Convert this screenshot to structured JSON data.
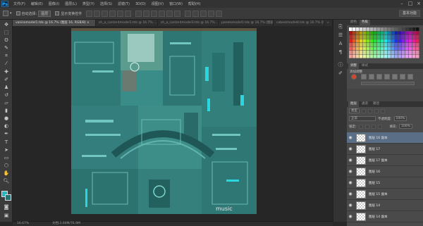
{
  "app": {
    "logo": "Ps"
  },
  "menubar": {
    "items": [
      "文件(F)",
      "编辑(E)",
      "图像(I)",
      "图层(L)",
      "类型(Y)",
      "选择(S)",
      "滤镜(T)",
      "3D(D)",
      "视图(V)",
      "窗口(W)",
      "帮助(H)"
    ]
  },
  "options": {
    "auto_select_label": "自动选择:",
    "auto_select_value": "图层",
    "show_transform_label": "显示变换控件",
    "workspace": "基本功能"
  },
  "tabs": [
    {
      "label": "vanisemodel1.tds @ 16.7% (图层 16, RGB/8) ×",
      "active": true
    },
    {
      "label": "sh_a_cantentmodel1.tds @ 16.7% ...",
      "active": false
    },
    {
      "label": "sh_a_cantentmodel3.tds @ 16.7% ...",
      "active": false
    },
    {
      "label": "panelsmodel1.tds @ 16.7% (图层 1)  ...",
      "active": false
    },
    {
      "label": "cabestmodel4.tds @ 16.7% (图层 1) ...",
      "active": false
    },
    {
      "label": "»",
      "active": false
    }
  ],
  "canvas": {
    "watermark": "music"
  },
  "status": {
    "zoom": "16.67%",
    "doc_info": "文档:3.00M/76.9M"
  },
  "panels": {
    "swatch_tabs": [
      "颜色",
      "色板"
    ],
    "styles_tabs": [
      "调整",
      "样式"
    ],
    "styles_label": "添加调整",
    "layers_tabs": [
      "图层",
      "通道",
      "路径"
    ],
    "filter_kind": "类型",
    "blend_mode": "正常",
    "opacity_label": "不透明度:",
    "opacity_value": "100%",
    "lock_label": "锁定:",
    "fill_label": "填充:",
    "fill_value": "100%",
    "layers": [
      {
        "name": "图层 16 副本",
        "selected": true
      },
      {
        "name": "图层 17",
        "selected": false
      },
      {
        "name": "图层 17 副本",
        "selected": false
      },
      {
        "name": "图层 16",
        "selected": false
      },
      {
        "name": "图层 15",
        "selected": false
      },
      {
        "name": "图层 15 副本",
        "selected": false
      },
      {
        "name": "图层 14",
        "selected": false
      },
      {
        "name": "图层 14 副本",
        "selected": false
      }
    ]
  },
  "colors": {
    "foreground": "#24b8c4",
    "background": "#2a6e72",
    "accent_selection": "#5a6e86",
    "canvas_base": "#3b8f8a"
  }
}
